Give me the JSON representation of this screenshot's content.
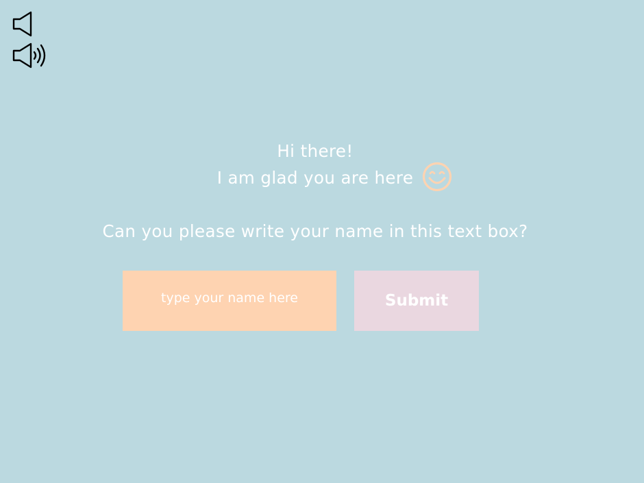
{
  "icons": {
    "mute": "speaker-mute-icon",
    "volume": "speaker-volume-icon",
    "smiley": "smiley-face-icon"
  },
  "greeting": {
    "line1": "Hi there!",
    "line2": "I am glad you are here"
  },
  "question": "Can you please write your name in this text box?",
  "form": {
    "name_value": "",
    "name_placeholder": "type your name here",
    "submit_label": "Submit"
  },
  "colors": {
    "background": "#bbd9e0",
    "input_bg": "#fed3b1",
    "button_bg": "#ead7e0",
    "text": "#ffffff",
    "smiley": "#fed3b1"
  }
}
